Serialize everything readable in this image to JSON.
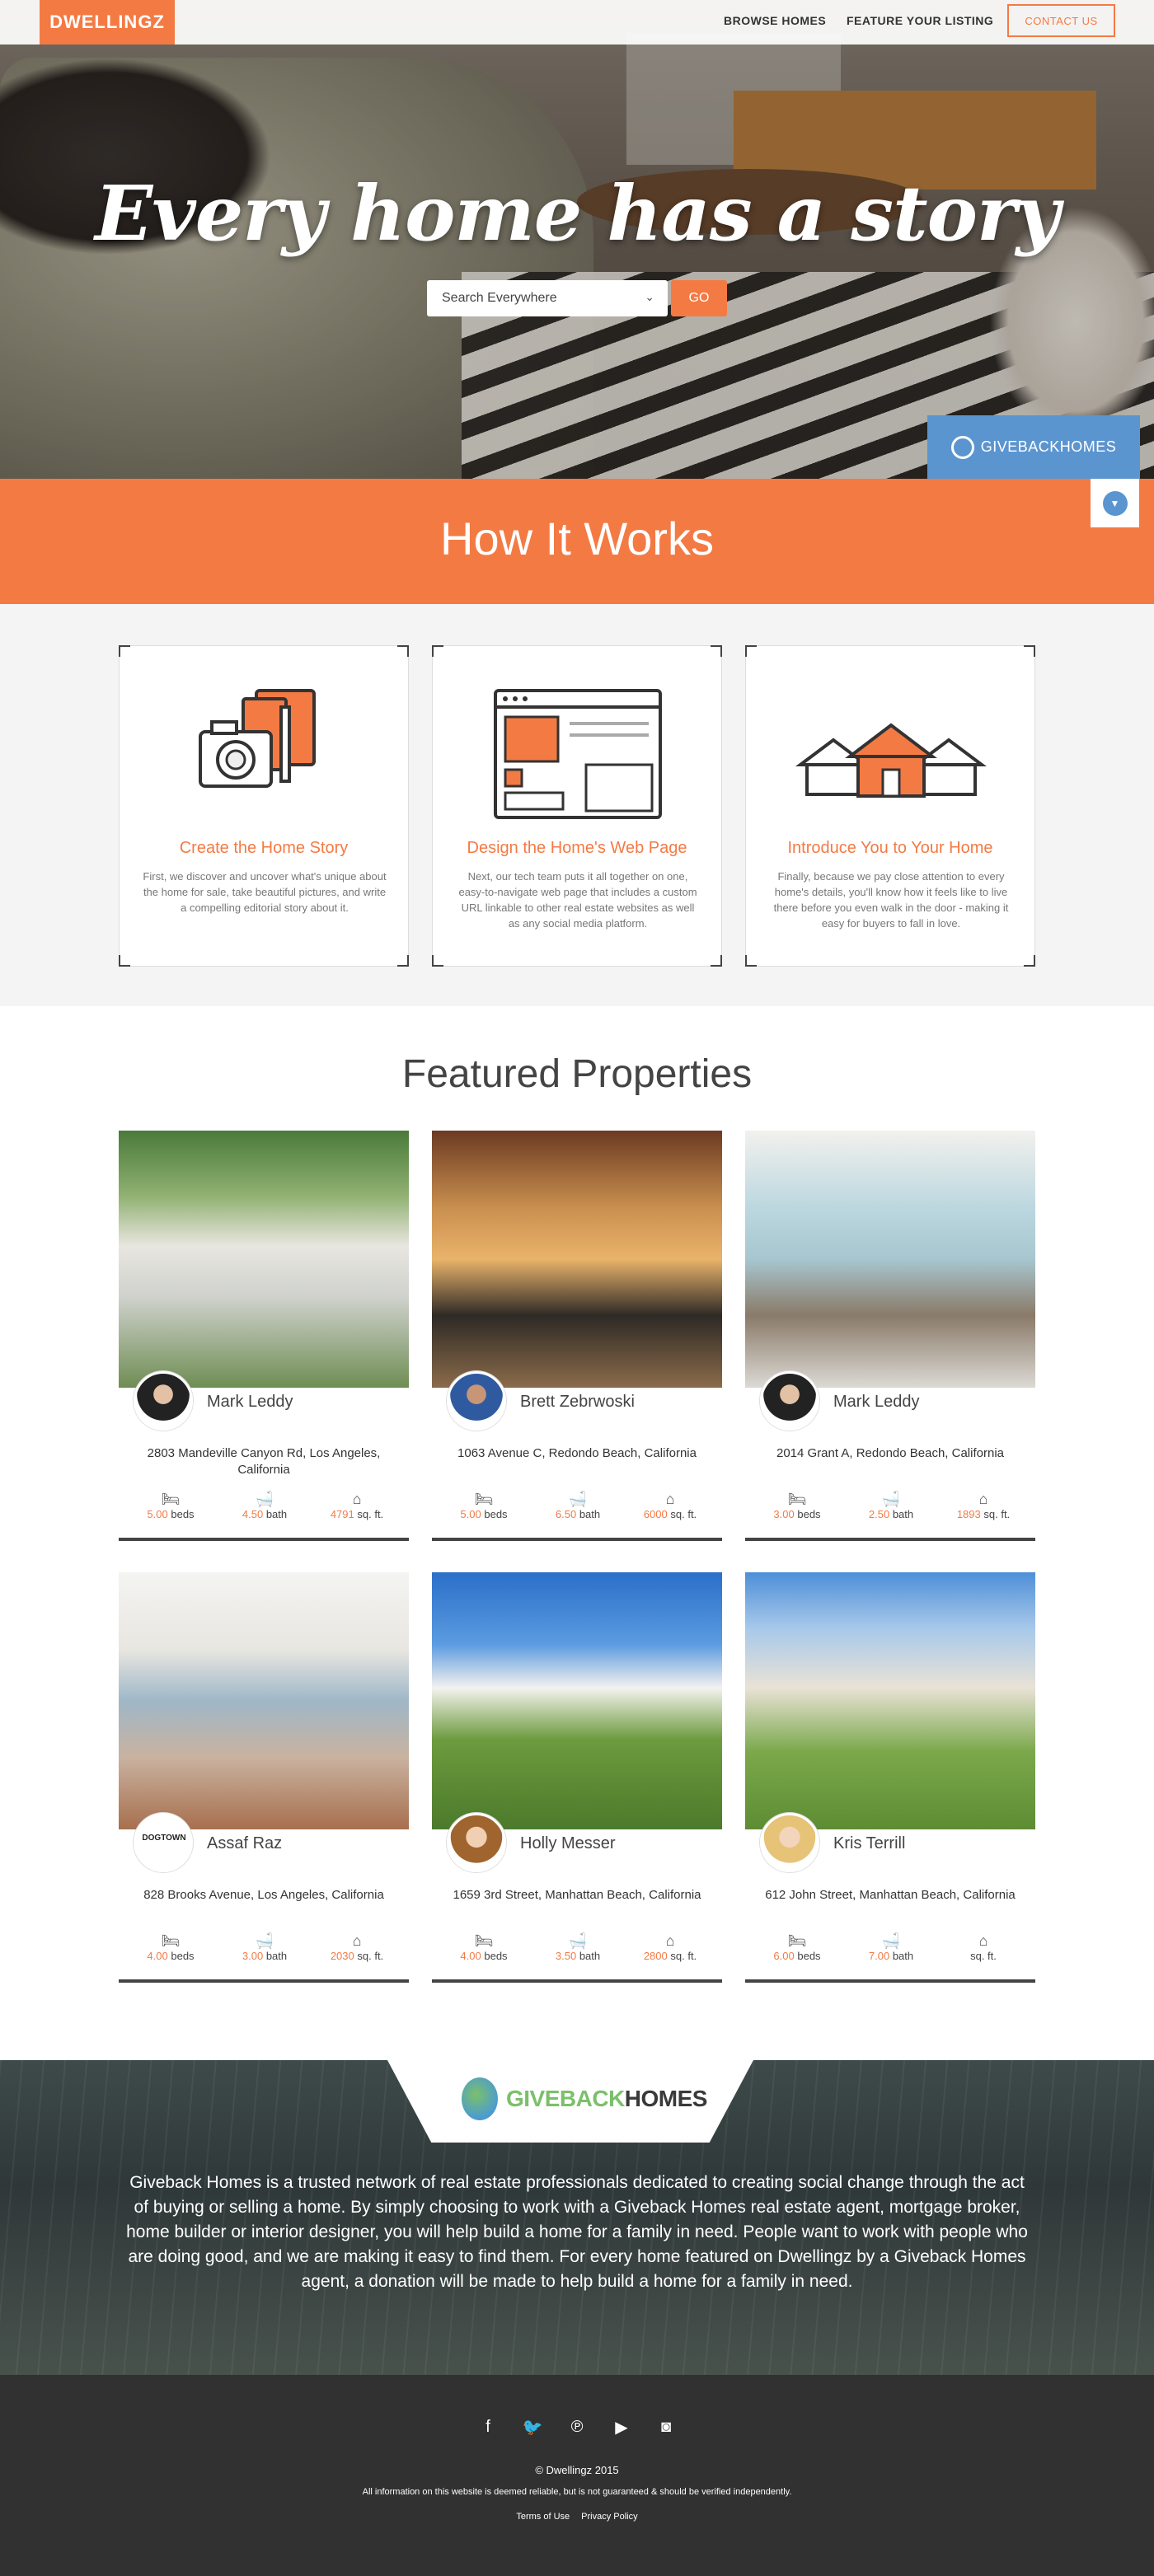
{
  "nav": {
    "logo": "DWELLINGZ",
    "browse": "BROWSE HOMES",
    "feature": "FEATURE YOUR LISTING",
    "contact": "CONTACT US"
  },
  "hero": {
    "title": "Every home has a story",
    "search_placeholder": "Search Everywhere",
    "go": "GO",
    "badge": "GIVEBACKHOMES"
  },
  "how": {
    "title": "How It Works",
    "steps": [
      {
        "title": "Create the Home Story",
        "text": "First, we discover and uncover what's unique about the home for sale, take beautiful pictures, and write a compelling editorial story about it."
      },
      {
        "title": "Design the Home's Web Page",
        "text": "Next, our tech team puts it all together on one, easy-to-navigate web page that includes a custom URL linkable to other real estate websites as well as any social media platform."
      },
      {
        "title": "Introduce You to Your Home",
        "text": "Finally, because we pay close attention to every home's details, you'll know how it feels like to live there before you even walk in the door - making it easy for buyers to fall in love."
      }
    ]
  },
  "featured": {
    "title": "Featured Properties",
    "properties": [
      {
        "agent": "Mark Leddy",
        "address": "2803 Mandeville Canyon Rd, Los Angeles, California",
        "beds": "5.00",
        "baths": "4.50",
        "sqft": "4791"
      },
      {
        "agent": "Brett Zebrwoski",
        "address": "1063 Avenue C, Redondo Beach, California",
        "beds": "5.00",
        "baths": "6.50",
        "sqft": "6000"
      },
      {
        "agent": "Mark Leddy",
        "address": "2014 Grant A, Redondo Beach, California",
        "beds": "3.00",
        "baths": "2.50",
        "sqft": "1893"
      },
      {
        "agent": "Assaf Raz",
        "address": "828 Brooks Avenue, Los Angeles, California",
        "beds": "4.00",
        "baths": "3.00",
        "sqft": "2030"
      },
      {
        "agent": "Holly Messer",
        "address": "1659 3rd Street, Manhattan Beach, California",
        "beds": "4.00",
        "baths": "3.50",
        "sqft": "2800"
      },
      {
        "agent": "Kris Terrill",
        "address": "612 John Street, Manhattan Beach, California",
        "beds": "6.00",
        "baths": "7.00",
        "sqft": ""
      }
    ],
    "labels": {
      "beds": "beds",
      "bath": "bath",
      "sqft": "sq. ft."
    },
    "avatar_logo_text": "DOGTOWN"
  },
  "giveback": {
    "logo_green": "GIVEBACK",
    "logo_dark": "HOMES",
    "text": "Giveback Homes is a trusted network of real estate professionals dedicated to creating social change through the act of buying or selling a home. By simply choosing to work with a Giveback Homes real estate agent, mortgage broker, home builder or interior designer, you will help build a home for a family in need. People want to work with people who are doing good, and we are making it easy to find them. For every home featured on Dwellingz by a Giveback Homes agent, a donation will be made to help build a home for a family in need."
  },
  "footer": {
    "socials": [
      "facebook-icon",
      "twitter-icon",
      "pinterest-icon",
      "youtube-icon",
      "instagram-icon"
    ],
    "copyright": "© Dwellingz 2015",
    "disclaimer": "All information on this website is deemed reliable, but is not guaranteed & should be verified independently.",
    "terms": "Terms of Use",
    "privacy": "Privacy Policy"
  },
  "colors": {
    "accent": "#f47a44",
    "blue": "#5b95d0",
    "footer": "#313131"
  }
}
